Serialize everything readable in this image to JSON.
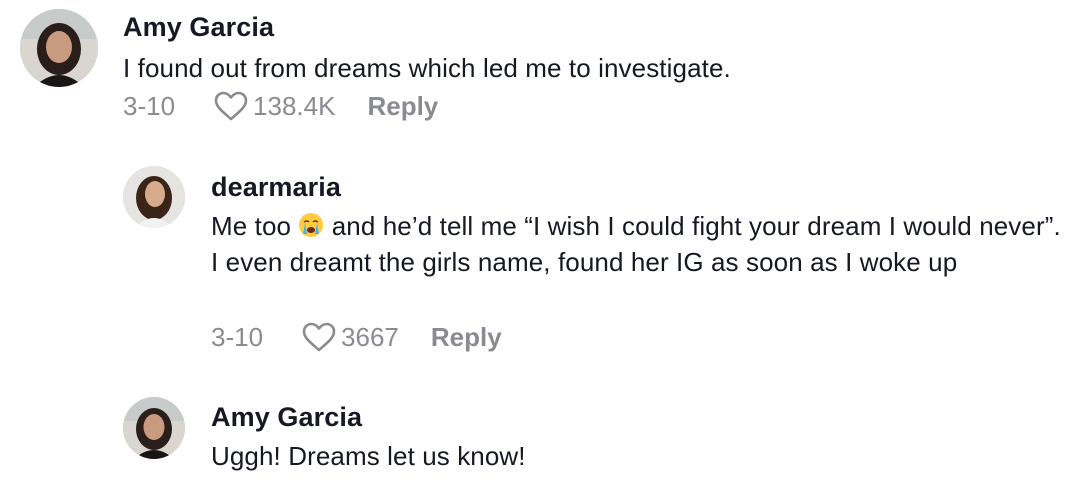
{
  "comments": [
    {
      "username": "Amy Garcia",
      "text": "I found out from dreams which led me to investigate.",
      "date": "3-10",
      "likes": "138.4K",
      "reply_label": "Reply"
    },
    {
      "username": "dearmaria",
      "text_before_emoji": "Me too ",
      "emoji": "crying-face",
      "text_after_emoji": " and he’d tell me “I wish I could fight your dream I would never”. I even dreamt the girls name, found her IG as soon as I woke up",
      "date": "3-10",
      "likes": "3667",
      "reply_label": "Reply"
    },
    {
      "username": "Amy Garcia",
      "text": "Uggh! Dreams let us know!"
    }
  ],
  "colors": {
    "text": "#161823",
    "meta": "#8a8b91"
  }
}
